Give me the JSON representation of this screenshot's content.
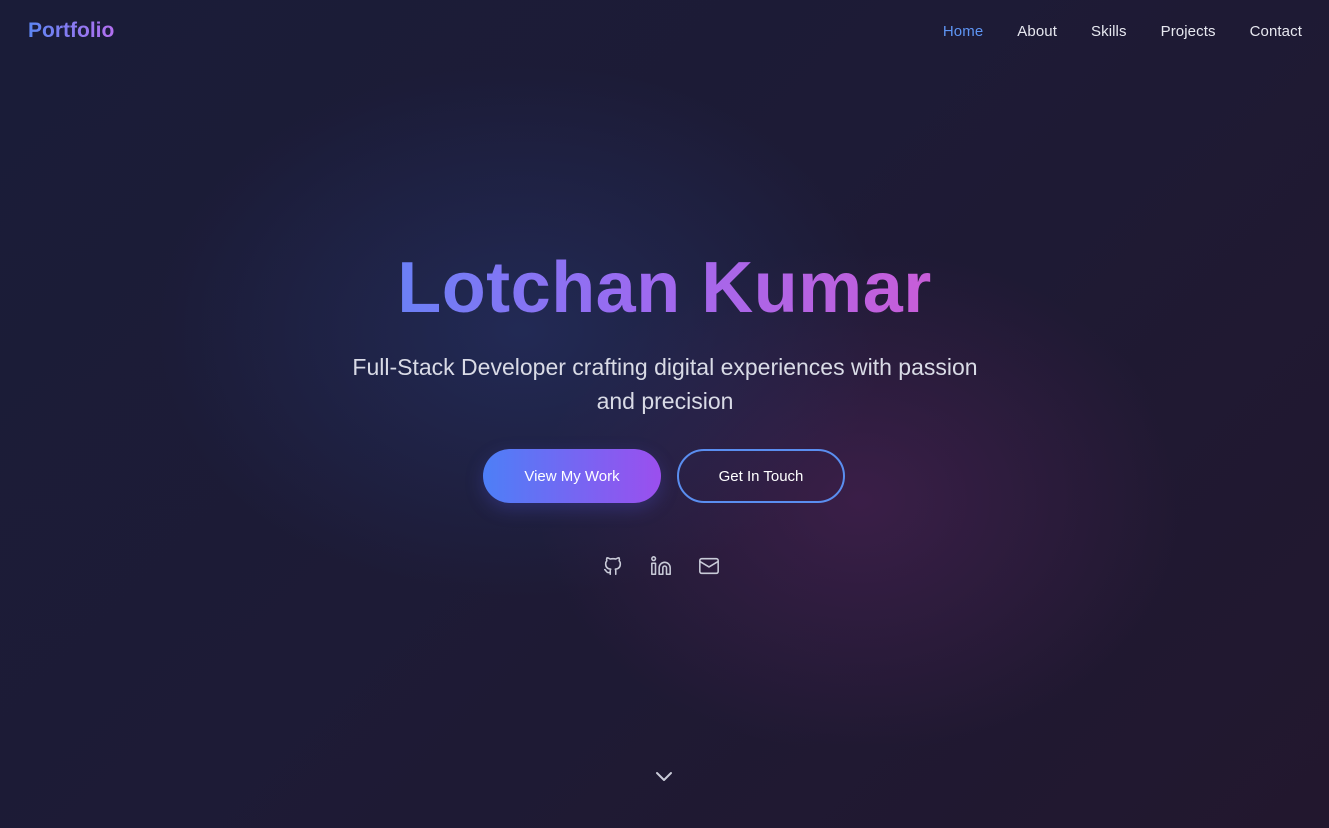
{
  "nav": {
    "brand": "Portfolio",
    "links": [
      {
        "label": "Home",
        "active": true
      },
      {
        "label": "About",
        "active": false
      },
      {
        "label": "Skills",
        "active": false
      },
      {
        "label": "Projects",
        "active": false
      },
      {
        "label": "Contact",
        "active": false
      }
    ]
  },
  "hero": {
    "name": "Lotchan Kumar",
    "subtitle": "Full-Stack Developer crafting digital experiences with passion and precision",
    "primary_button": "View My Work",
    "secondary_button": "Get In Touch",
    "socials": [
      {
        "icon": "github-icon"
      },
      {
        "icon": "linkedin-icon"
      },
      {
        "icon": "mail-icon"
      }
    ],
    "scroll_icon": "chevron-down-icon"
  },
  "colors": {
    "accent_blue": "#5e95f4",
    "accent_purple": "#9b4fee",
    "accent_pink": "#c85dd8",
    "background": "#1b1a33",
    "text": "#e7e8f0"
  }
}
